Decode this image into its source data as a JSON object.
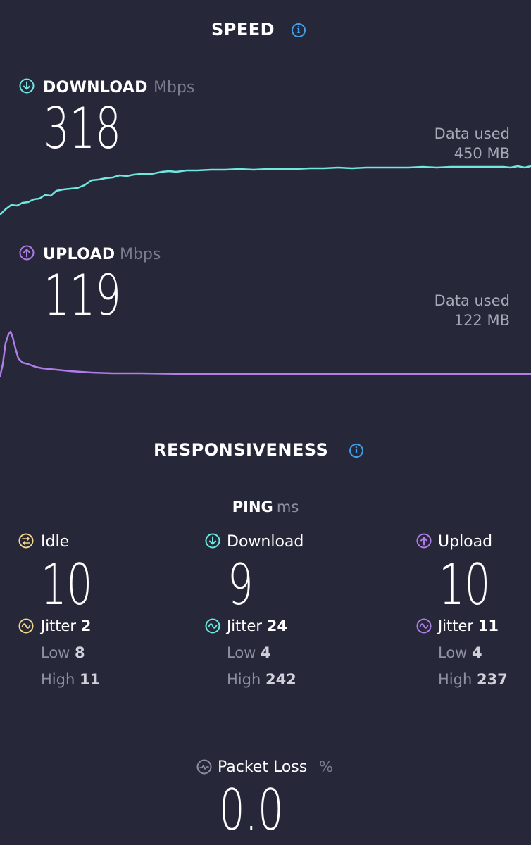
{
  "speed": {
    "title": "SPEED",
    "download": {
      "label": "DOWNLOAD",
      "unit": "Mbps",
      "value": "318",
      "data_used_label": "Data used",
      "data_used_value": "450 MB",
      "color": "#6ee8e0"
    },
    "upload": {
      "label": "UPLOAD",
      "unit": "Mbps",
      "value": "119",
      "data_used_label": "Data used",
      "data_used_value": "122 MB",
      "color": "#b07ce8"
    }
  },
  "responsiveness": {
    "title": "RESPONSIVENESS",
    "ping_label": "PING",
    "ping_unit": "ms",
    "idle": {
      "label": "Idle",
      "value": "10",
      "jitter_label": "Jitter",
      "jitter": "2",
      "low_label": "Low",
      "low": "8",
      "high_label": "High",
      "high": "11",
      "color": "#f2d48a"
    },
    "download": {
      "label": "Download",
      "value": "9",
      "jitter_label": "Jitter",
      "jitter": "24",
      "low_label": "Low",
      "low": "4",
      "high_label": "High",
      "high": "242",
      "color": "#6ee8e0"
    },
    "upload": {
      "label": "Upload",
      "value": "10",
      "jitter_label": "Jitter",
      "jitter": "11",
      "low_label": "Low",
      "low": "4",
      "high_label": "High",
      "high": "237",
      "color": "#b07ce8"
    }
  },
  "packet_loss": {
    "label": "Packet Loss",
    "unit": "%",
    "value": "0.0"
  }
}
